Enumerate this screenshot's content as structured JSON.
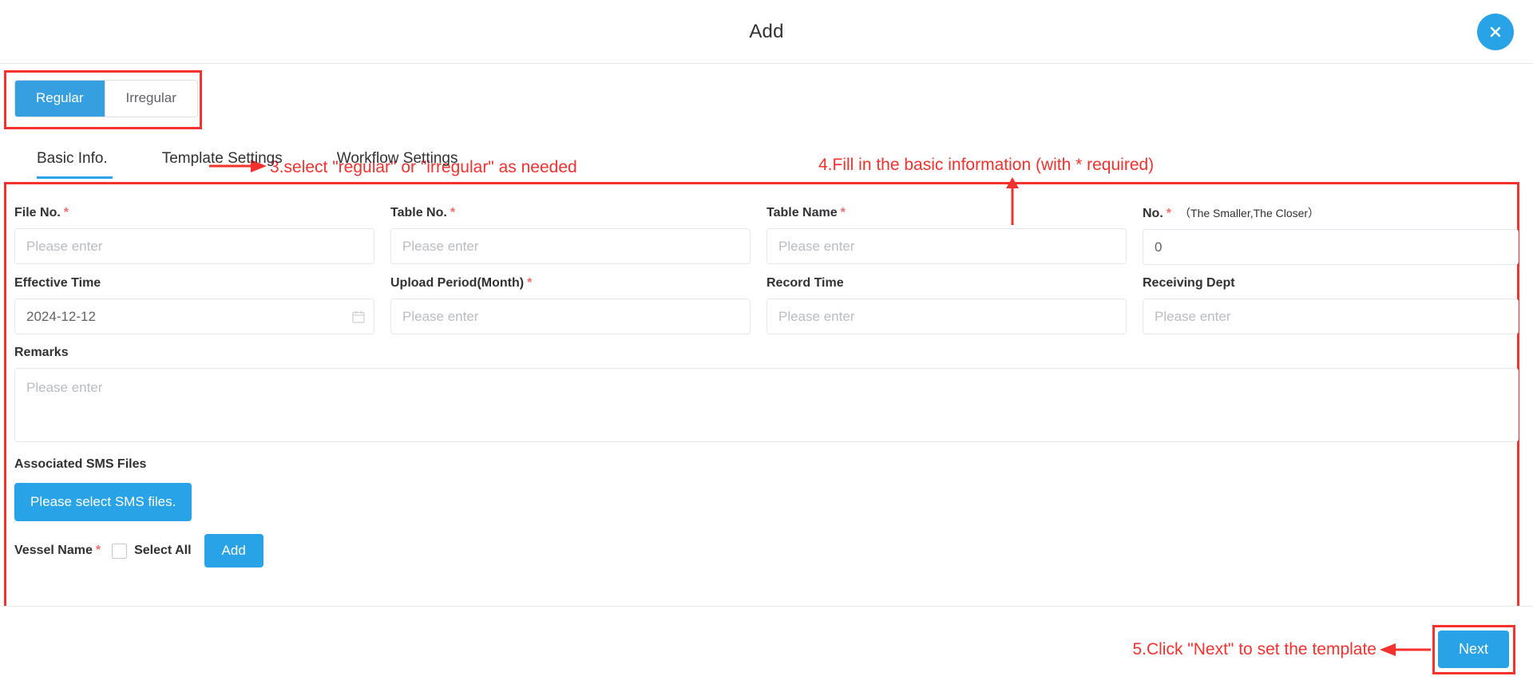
{
  "header": {
    "title": "Add",
    "close_icon": "close-icon"
  },
  "mode_selector": {
    "options": [
      "Regular",
      "Irregular"
    ],
    "selected": "Regular"
  },
  "tabs": [
    {
      "label": "Basic Info.",
      "active": true
    },
    {
      "label": "Template Settings",
      "active": false
    },
    {
      "label": "Workflow Settings",
      "active": false
    }
  ],
  "form": {
    "placeholder": "Please enter",
    "fields": {
      "file_no": {
        "label": "File No.",
        "required": true,
        "value": "",
        "placeholder": "Please enter"
      },
      "table_no": {
        "label": "Table No.",
        "required": true,
        "value": "",
        "placeholder": "Please enter"
      },
      "table_name": {
        "label": "Table Name",
        "required": true,
        "value": "",
        "placeholder": "Please enter"
      },
      "no": {
        "label": "No.",
        "required": true,
        "hint": "（The Smaller,The Closer）",
        "value": "0"
      },
      "effective_time": {
        "label": "Effective Time",
        "required": false,
        "value": "2024-12-12",
        "icon": "calendar-icon"
      },
      "upload_period": {
        "label": "Upload Period(Month)",
        "required": true,
        "value": "",
        "placeholder": "Please enter"
      },
      "record_time": {
        "label": "Record Time",
        "required": false,
        "value": "",
        "placeholder": "Please enter"
      },
      "receiving_dept": {
        "label": "Receiving Dept",
        "required": false,
        "value": "",
        "placeholder": "Please enter"
      },
      "remarks": {
        "label": "Remarks",
        "required": false,
        "value": "",
        "placeholder": "Please enter"
      },
      "associated_sms_files": {
        "label": "Associated SMS Files",
        "button_label": "Please select SMS files."
      },
      "vessel_name": {
        "label": "Vessel Name",
        "required": true,
        "select_all_label": "Select All",
        "select_all_checked": false,
        "add_button_label": "Add"
      }
    }
  },
  "footer": {
    "next_label": "Next"
  },
  "annotations": {
    "step3": "3.select \"regular\" or \"irregular\" as needed",
    "step4": "4.Fill in the basic information (with * required)",
    "step5": "5.Click \"Next\" to set the template",
    "color": "#f5312d"
  }
}
